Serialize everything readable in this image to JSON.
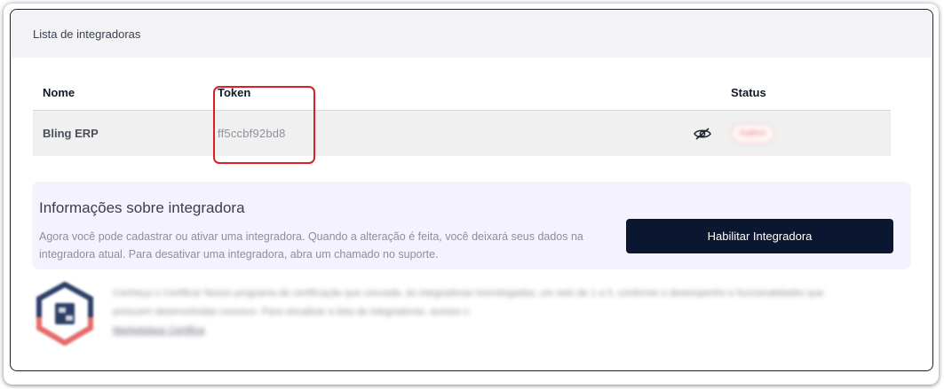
{
  "card": {
    "title": "Lista de integradoras"
  },
  "table": {
    "headers": {
      "name": "Nome",
      "token": "Token",
      "status": "Status"
    },
    "rows": [
      {
        "name": "Bling ERP",
        "token": "ff5ccbf92bd8",
        "status": "Inativo"
      }
    ]
  },
  "info": {
    "title": "Informações sobre integradora",
    "text": "Agora você pode cadastrar ou ativar uma integradora. Quando a alteração é feita, você deixará seus dados na integradora atual. Para desativar uma integradora, abra um chamado no suporte.",
    "button_label": "Habilitar Integradora"
  },
  "certification": {
    "text": "Conheça o Certifica! Nosso programa de certificação que concede, às integradoras homologadas, um selo de 1 a 5, conforme o desempenho e funcionalidades que possuem desenvolvidas conosco. Para visualizar a lista de integradoras, acesse o",
    "link_label": "Marketplace Certifica"
  },
  "icons": {
    "visibility": "eye-off-icon",
    "certification": "certifica-badge-icon"
  },
  "colors": {
    "primary_button": "#0b1630",
    "highlight": "#dc1f26",
    "info_background": "#f4f2fc",
    "status_inactive": "#e8898c"
  }
}
